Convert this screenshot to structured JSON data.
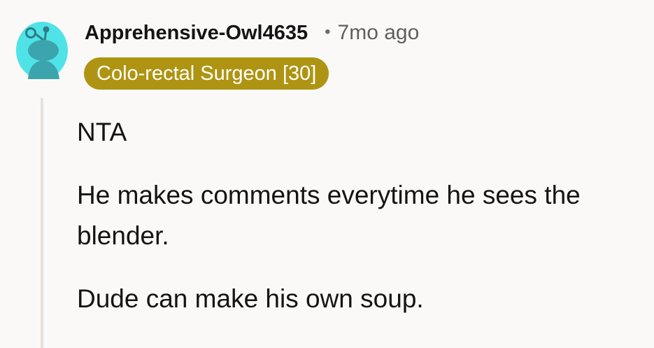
{
  "comment": {
    "author": "Apprehensive-Owl4635",
    "separator": "•",
    "timestamp": "7mo ago",
    "flair": "Colo-rectal Surgeon [30]",
    "paragraphs": [
      "NTA",
      "He makes comments everytime he sees the blender.",
      "Dude can make his own soup."
    ],
    "avatar_icon": "snoo-avatar-icon",
    "colors": {
      "avatar_bg": "#4fe3e8",
      "avatar_figure": "#3ba4ac",
      "flair_bg": "#ae9412",
      "flair_text": "#ffffff",
      "thread_line": "#e8e0db",
      "page_bg": "#fbf9f8"
    }
  }
}
